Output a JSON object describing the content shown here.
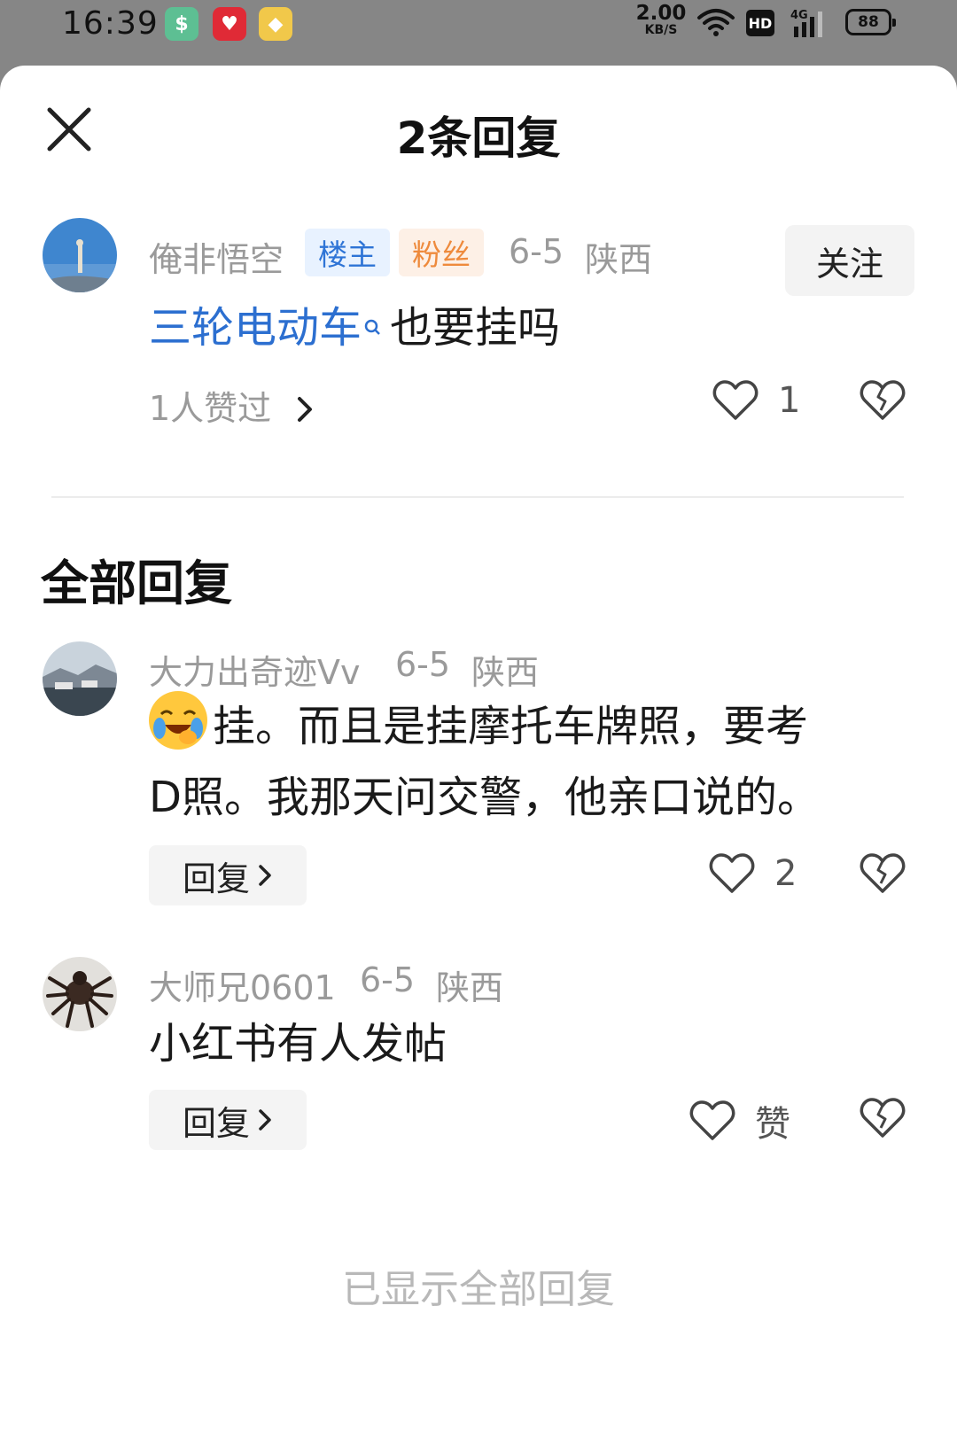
{
  "status_bar": {
    "time": "16:39",
    "net_speed": "2.00",
    "net_unit": "KB/S",
    "hd": "HD",
    "network": "4G",
    "battery": "88",
    "app_icons": [
      "wallet-app-icon",
      "gift-app-icon",
      "coupon-app-icon"
    ]
  },
  "header": {
    "title": "2条回复",
    "close_icon": "close-icon"
  },
  "op_comment": {
    "username": "俺非悟空",
    "owner_tag": "楼主",
    "fan_tag": "粉丝",
    "date": "6-5",
    "location": "陕西",
    "follow_label": "关注",
    "link_text": "三轮电动车",
    "text": "也要挂吗",
    "likers": "1人赞过",
    "like_count": "1"
  },
  "section_title": "全部回复",
  "replies": [
    {
      "username": "大力出奇迹Vv",
      "date": "6-5",
      "location": "陕西",
      "line1": "挂。而且是挂摩托车牌照，要考",
      "line2": "D照。我那天问交警，他亲口说的。",
      "reply_label": "回复",
      "like_count": "2"
    },
    {
      "username": "大师兄0601",
      "date": "6-5",
      "location": "陕西",
      "line1": "小红书有人发帖",
      "reply_label": "回复",
      "like_label": "赞"
    }
  ],
  "footer": "已显示全部回复",
  "colors": {
    "link": "#2c6fd0",
    "owner_tag": "#2e74d6",
    "fan_tag": "#ee8a3c"
  }
}
